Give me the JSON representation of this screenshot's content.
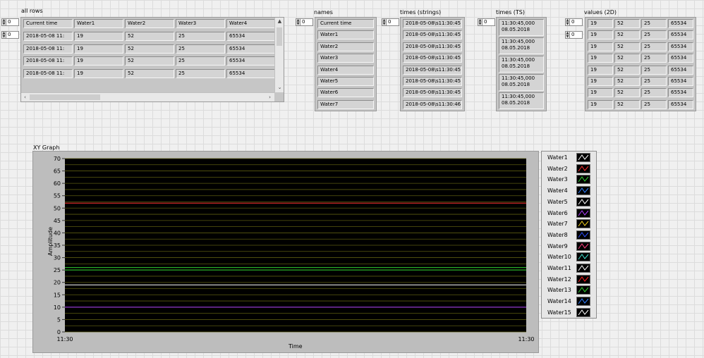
{
  "all_rows": {
    "label": "all rows",
    "index_row": "0",
    "index_col": "0",
    "headers": [
      "Current time",
      "Water1",
      "Water2",
      "Water3",
      "Water4"
    ],
    "rows": [
      [
        "2018-05-08 11:",
        "19",
        "52",
        "25",
        "65534"
      ],
      [
        "2018-05-08 11:",
        "19",
        "52",
        "25",
        "65534"
      ],
      [
        "2018-05-08 11:",
        "19",
        "52",
        "25",
        "65534"
      ],
      [
        "2018-05-08 11:",
        "19",
        "52",
        "25",
        "65534"
      ]
    ]
  },
  "names": {
    "label": "names",
    "index": "0",
    "items": [
      "Current time",
      "Water1",
      "Water2",
      "Water3",
      "Water4",
      "Water5",
      "Water6",
      "Water7"
    ]
  },
  "times_strings": {
    "label": "times (strings)",
    "index": "0",
    "items": [
      "2018-05-08\\s11:30:45",
      "2018-05-08\\s11:30:45",
      "2018-05-08\\s11:30:45",
      "2018-05-08\\s11:30:45",
      "2018-05-08\\s11:30:45",
      "2018-05-08\\s11:30:45",
      "2018-05-08\\s11:30:45",
      "2018-05-08\\s11:30:46"
    ]
  },
  "times_ts": {
    "label": "times (TS)",
    "index": "0",
    "items": [
      {
        "time": "11:30:45,000",
        "date": "08.05.2018"
      },
      {
        "time": "11:30:45,000",
        "date": "08.05.2018"
      },
      {
        "time": "11:30:45,000",
        "date": "08.05.2018"
      },
      {
        "time": "11:30:45,000",
        "date": "08.05.2018"
      },
      {
        "time": "11:30:45,000",
        "date": "08.05.2018"
      }
    ]
  },
  "values_2d": {
    "label": "values (2D)",
    "index_row": "0",
    "index_col": "0",
    "rows": [
      [
        "19",
        "52",
        "25",
        "65534"
      ],
      [
        "19",
        "52",
        "25",
        "65534"
      ],
      [
        "19",
        "52",
        "25",
        "65534"
      ],
      [
        "19",
        "52",
        "25",
        "65534"
      ],
      [
        "19",
        "52",
        "25",
        "65534"
      ],
      [
        "19",
        "52",
        "25",
        "65534"
      ],
      [
        "19",
        "52",
        "25",
        "65534"
      ],
      [
        "19",
        "52",
        "25",
        "65534"
      ]
    ]
  },
  "graph": {
    "label": "XY Graph",
    "plot_bg": "#000000",
    "grid_color": "#5a5a10"
  },
  "chart_data": {
    "type": "line",
    "title": "XY Graph",
    "xlabel": "Time",
    "ylabel": "Amplitude",
    "x_ticks": [
      "11:30",
      "11:30"
    ],
    "y_ticks": [
      0,
      5,
      10,
      15,
      20,
      25,
      30,
      35,
      40,
      45,
      50,
      55,
      60,
      65,
      70
    ],
    "ylim": [
      0,
      70
    ],
    "grid": true,
    "legend_position": "right",
    "series": [
      {
        "name": "Water1",
        "color": "#ffffff",
        "value": 19
      },
      {
        "name": "Water2",
        "color": "#ff3030",
        "value": 52
      },
      {
        "name": "Water3",
        "color": "#30d030",
        "value": 25
      },
      {
        "name": "Water4",
        "color": "#3080ff",
        "value": null
      },
      {
        "name": "Water5",
        "color": "#ffffff",
        "value": null
      },
      {
        "name": "Water6",
        "color": "#b040ff",
        "value": 10
      },
      {
        "name": "Water7",
        "color": "#f0d020",
        "value": null
      },
      {
        "name": "Water8",
        "color": "#3050ff",
        "value": null
      },
      {
        "name": "Water9",
        "color": "#ff4080",
        "value": null
      },
      {
        "name": "Water10",
        "color": "#40e0d0",
        "value": null
      },
      {
        "name": "Water11",
        "color": "#ffffff",
        "value": null
      },
      {
        "name": "Water12",
        "color": "#ff2020",
        "value": null
      },
      {
        "name": "Water13",
        "color": "#30d030",
        "value": 26
      },
      {
        "name": "Water14",
        "color": "#3080ff",
        "value": null
      },
      {
        "name": "Water15",
        "color": "#ffffff",
        "value": null
      }
    ]
  }
}
